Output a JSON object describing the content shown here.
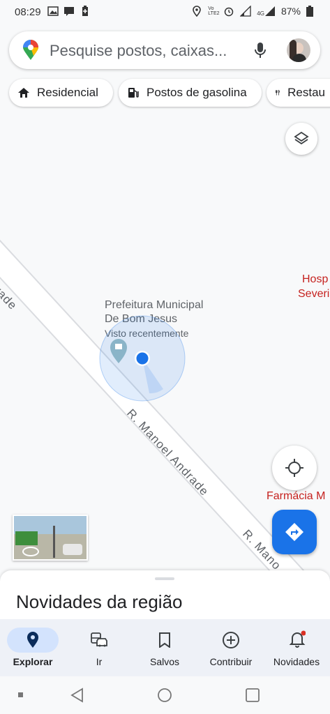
{
  "status_bar": {
    "time": "08:29",
    "battery": "87%",
    "volte_label": "Vo LTE2",
    "network_label": "4G"
  },
  "search": {
    "placeholder": "Pesquise postos, caixas..."
  },
  "chips": [
    {
      "label": "Residencial",
      "icon": "home-icon"
    },
    {
      "label": "Postos de gasolina",
      "icon": "gas-station-icon"
    },
    {
      "label": "Restau",
      "icon": "restaurant-icon"
    }
  ],
  "map": {
    "place_name_line1": "Prefeitura Municipal",
    "place_name_line2": "De Bom Jesus",
    "place_sub": "Visto recentemente",
    "street_main": "R. Manoel Andrade",
    "street_right": "R. Mano",
    "street_left": "ndrade",
    "hospital_line1": "Hosp",
    "hospital_line2": "Severi",
    "pharmacy": "Farmácia M",
    "colors": {
      "location_blue": "#1a73e8",
      "poi_red": "#c5221f",
      "poi_gray": "#70757a"
    }
  },
  "sheet": {
    "title": "Novidades da região"
  },
  "bottom_nav": {
    "items": [
      {
        "label": "Explorar",
        "icon": "explore-pin-icon",
        "active": true
      },
      {
        "label": "Ir",
        "icon": "car-transit-icon",
        "active": false
      },
      {
        "label": "Salvos",
        "icon": "bookmark-icon",
        "active": false
      },
      {
        "label": "Contribuir",
        "icon": "add-circle-icon",
        "active": false
      },
      {
        "label": "Novidades",
        "icon": "bell-icon",
        "active": false
      }
    ]
  }
}
